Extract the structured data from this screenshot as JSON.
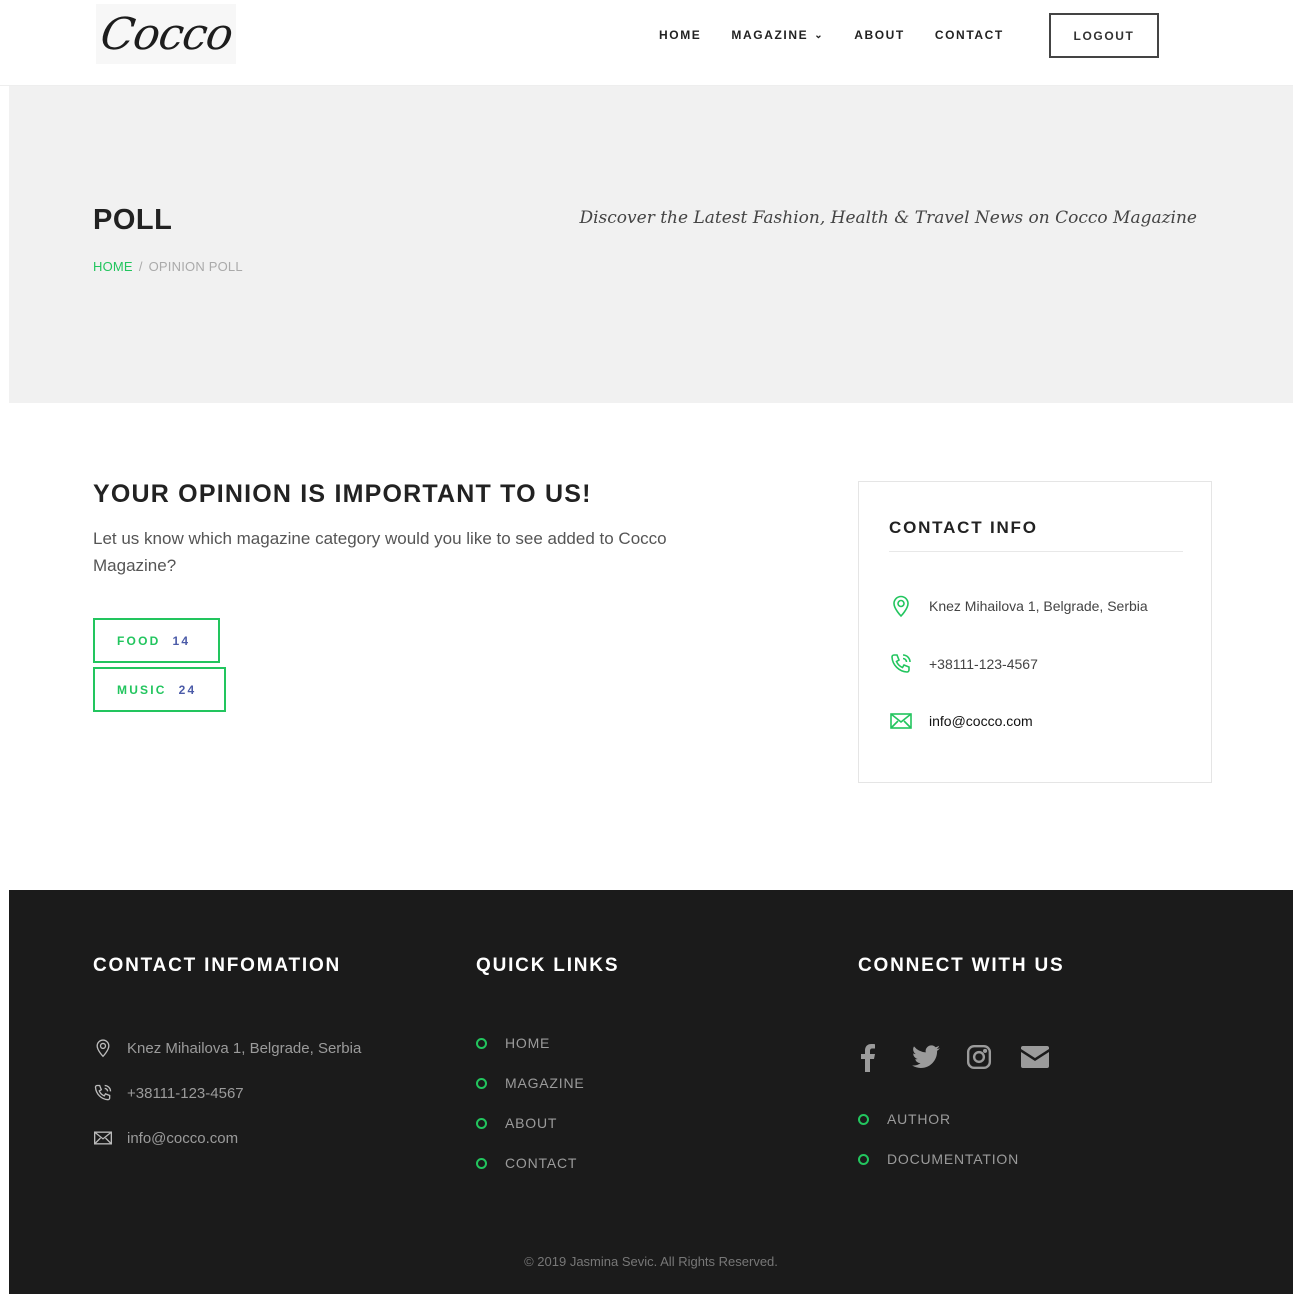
{
  "header": {
    "logo_text": "Cocco",
    "nav": [
      {
        "label": "HOME"
      },
      {
        "label": "MAGAZINE"
      },
      {
        "label": "ABOUT"
      },
      {
        "label": "CONTACT"
      }
    ],
    "logout_label": "LOGOUT"
  },
  "hero": {
    "title": "POLL",
    "tagline": "Discover the Latest Fashion, Health & Travel News on Cocco Magazine",
    "breadcrumb": {
      "home": "HOME",
      "separator": "/",
      "current": "OPINION POLL"
    }
  },
  "poll": {
    "heading": "YOUR OPINION IS IMPORTANT TO US!",
    "description": "Let us know which magazine category would you like to see added to Cocco Magazine?",
    "options": [
      {
        "label": "FOOD",
        "count": "14"
      },
      {
        "label": "MUSIC",
        "count": "24"
      }
    ]
  },
  "contact_card": {
    "title": "CONTACT INFO",
    "address": "Knez Mihailova 1, Belgrade, Serbia",
    "phone": "+38111-123-4567",
    "email": "info@cocco.com"
  },
  "footer": {
    "contact_title": "CONTACT INFOMATION",
    "address": "Knez Mihailova 1, Belgrade, Serbia",
    "phone": "+38111-123-4567",
    "email": "info@cocco.com",
    "links_title": "QUICK LINKS",
    "links": [
      {
        "label": "HOME"
      },
      {
        "label": "MAGAZINE"
      },
      {
        "label": "ABOUT"
      },
      {
        "label": "CONTACT"
      }
    ],
    "connect_title": "CONNECT WITH US",
    "social_icons": [
      "facebook-icon",
      "twitter-icon",
      "instagram-icon",
      "envelope-icon"
    ],
    "connect_links": [
      {
        "label": "AUTHOR"
      },
      {
        "label": "DOCUMENTATION"
      }
    ],
    "copyright": "© 2019 Jasmina Sevic. All Rights Reserved."
  },
  "colors": {
    "accent": "#22c55e",
    "count": "#4b5ba8",
    "footer_bg": "#1b1b1b",
    "hero_bg": "#f1f1f1"
  }
}
